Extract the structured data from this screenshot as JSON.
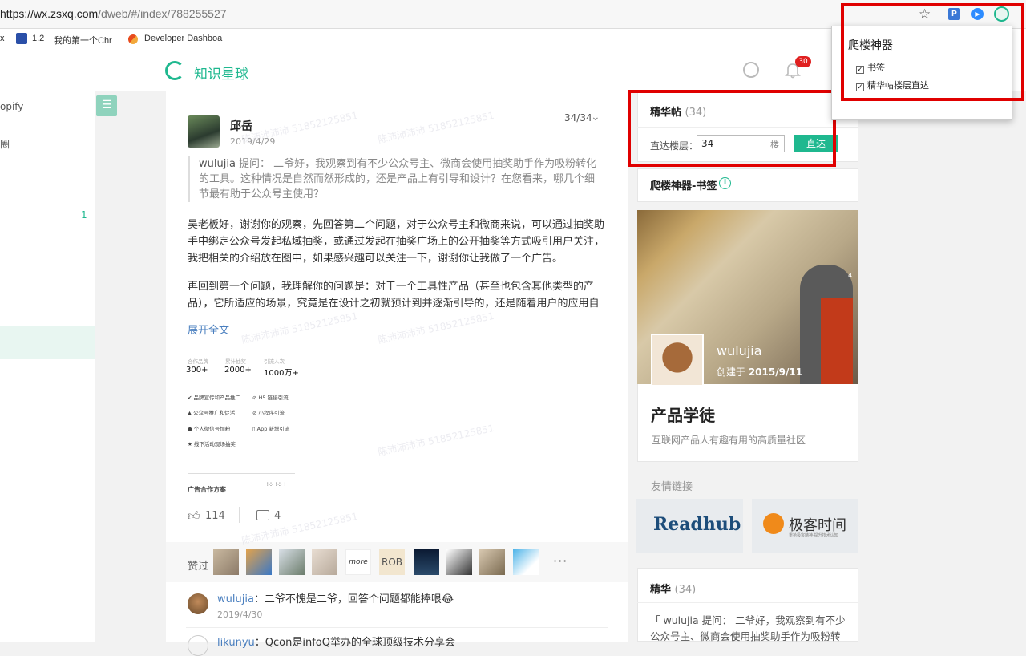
{
  "browser": {
    "url_host": "https://wx.zsxq.com",
    "url_path": "/dweb/#/index/788255527",
    "bookmarks": [
      {
        "label": "x"
      },
      {
        "label": "1.2"
      },
      {
        "label": "我的第一个Chr"
      },
      {
        "label": "Developer Dashboa"
      }
    ]
  },
  "header": {
    "logo_text": "知识星球",
    "notification_count": "30"
  },
  "sidebar": {
    "items": [
      {
        "label": "opify"
      },
      {
        "label": "圈"
      },
      {
        "label": "1"
      }
    ],
    "toggle_glyph": "☰"
  },
  "post": {
    "author": "邱岳",
    "date": "2019/4/29",
    "floor": "34/34",
    "question_asker": "wulujia",
    "question_text": " 提问： 二爷好，我观察到有不少公众号主、微商会使用抽奖助手作为吸粉转化的工具。这种情况是自然而然形成的，还是产品上有引导和设计？在您看来，哪几个细节最有助于公众号主使用？",
    "answer_p1": "吴老板好，谢谢你的观察，先回答第二个问题，对于公众号主和微商来说，可以通过抽奖助手中绑定公众号发起私域抽奖，或通过发起在抽奖广场上的公开抽奖等方式吸引用户关注，我把相关的介绍放在图中，如果感兴趣可以关注一下，谢谢你让我做了一个广告。",
    "answer_p2": "再回到第一个问题，我理解你的问题是：对于一个工具性产品（甚至也包含其他类型的产品），它所适应的场景，究竟是在设计之初就预计到并逐渐引导的，还是随着用户的应用自然",
    "expand_label": "展开全文",
    "image": {
      "stat_labels": [
        "合作品牌",
        "累计抽奖",
        "引流人次"
      ],
      "stat_values": [
        "300+",
        "2000+",
        "1000万+"
      ],
      "features": [
        "品牌宣传和产品推广",
        "H5 链接引流",
        "公众号推广和促活",
        "小程序引流",
        "个人微信号加粉",
        "App 新增引流",
        "线下活动现场抽奖"
      ],
      "footer": "广告合作方案"
    },
    "likes": "114",
    "comments": "4",
    "liked_label": "赞过",
    "more_label": "···",
    "watermark": "陈沛沛沛沛 51852125851"
  },
  "comments": [
    {
      "name": "wulujia",
      "text": "：二爷不愧是二爷，回答个问题都能捧哏😂",
      "date": "2019/4/30"
    },
    {
      "name": "likunyu",
      "text": "：Qcon是infoQ举办的全球顶级技术分享会",
      "date": ""
    }
  ],
  "digest": {
    "title": "精华帖",
    "count": "(34)",
    "jump_label": "直达楼层：",
    "jump_value": "34",
    "jump_suffix": "楼",
    "jump_button": "直达"
  },
  "bookmark_panel": {
    "title": "爬楼神器-书签",
    "info_glyph": "i"
  },
  "group": {
    "owner": "wulujia",
    "created_prefix": "创建于 ",
    "created_date": "2015/9/11",
    "name": "产品学徒",
    "desc": "互联网产品人有趣有用的高质量社区",
    "photo_badge": "4"
  },
  "links": {
    "title": "友情链接",
    "items": [
      {
        "label": "Readhub"
      },
      {
        "label": "极客时间"
      }
    ],
    "geek_sub": "重拾极客精神·提升技术认知"
  },
  "digest_preview": {
    "title": "精华",
    "count": "(34)",
    "text": "「 wulujia 提问： 二爷好，我观察到有不少公众号主、微商会使用抽奖助手作为吸粉转"
  },
  "extension_popup": {
    "title": "爬楼神器",
    "options": [
      {
        "label": "书签",
        "checked": true
      },
      {
        "label": "精华帖楼层直达",
        "checked": true
      }
    ]
  },
  "toolbar": {
    "star": "☆",
    "ext_p": "P",
    "ext_zoom": "▶"
  },
  "colors": {
    "brand": "#1fb88f",
    "highlight_box": "#e00000",
    "link": "#4a7fbf"
  }
}
